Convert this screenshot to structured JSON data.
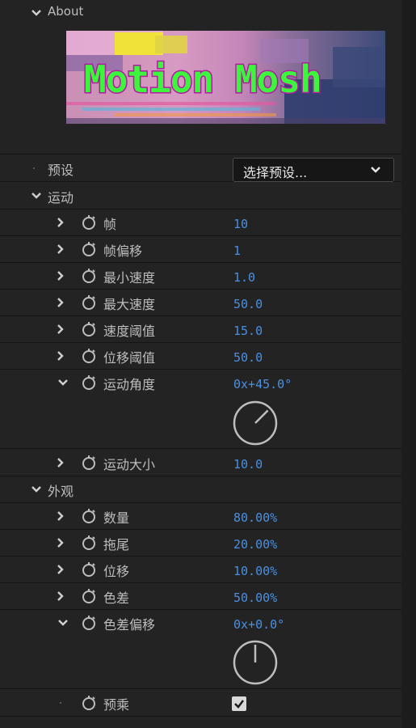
{
  "about": {
    "label": "About",
    "banner_text": "Motion Mosh"
  },
  "preset": {
    "label": "预设",
    "dropdown_value": "选择预设..."
  },
  "motion_group": {
    "label": "运动",
    "items": [
      {
        "label": "帧",
        "value": "10"
      },
      {
        "label": "帧偏移",
        "value": "1"
      },
      {
        "label": "最小速度",
        "value": "1.0"
      },
      {
        "label": "最大速度",
        "value": "50.0"
      },
      {
        "label": "速度阈值",
        "value": "15.0"
      },
      {
        "label": "位移阈值",
        "value": "50.0"
      },
      {
        "label": "运动角度",
        "value": "0x+45.0°",
        "angle_deg": 45
      },
      {
        "label": "运动大小",
        "value": "10.0"
      }
    ]
  },
  "appearance_group": {
    "label": "外观",
    "items": [
      {
        "label": "数量",
        "value": "80.00%"
      },
      {
        "label": "拖尾",
        "value": "20.00%"
      },
      {
        "label": "位移",
        "value": "10.00%"
      },
      {
        "label": "色差",
        "value": "50.00%"
      },
      {
        "label": "色差偏移",
        "value": "0x+0.0°",
        "angle_deg": 0
      },
      {
        "label": "预乘",
        "checked": true
      }
    ]
  },
  "colors": {
    "value_blue": "#4a90e2",
    "banner_green": "#3df53d"
  }
}
